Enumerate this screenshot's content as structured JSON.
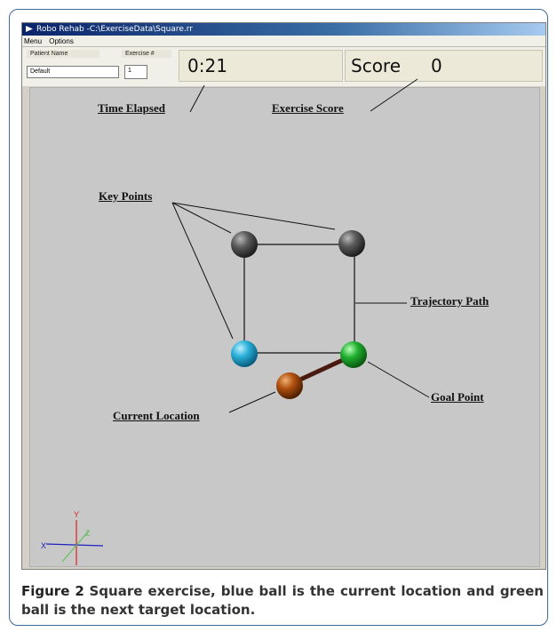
{
  "window": {
    "title": "Robo Rehab   -C:\\ExerciseData\\Square.rr",
    "menu": [
      "Menu",
      "Options"
    ]
  },
  "header": {
    "patient_name_label": "Patient Name",
    "patient_name_value": "Default",
    "exercise_label": "Exercise #",
    "exercise_value": "1",
    "time_value": "0:21",
    "score_label": "Score",
    "score_value": "0"
  },
  "annotations": {
    "time_elapsed": "Time Elapsed",
    "exercise_score": "Exercise Score",
    "key_points": "Key Points",
    "trajectory_path": "Trajectory Path",
    "goal_point": "Goal Point",
    "current_location": "Current Location"
  },
  "axes": {
    "x": "X",
    "y": "Y",
    "z": "Z"
  },
  "colors": {
    "key_point": "#5a5a5a",
    "current_point": "#2ab0d8",
    "goal_point": "#20b030",
    "cursor_ball": "#b05010",
    "link_bar": "#4a1a10",
    "title_bar": "#0a246a"
  },
  "caption": {
    "label": "Figure 2",
    "text": "Square exercise, blue ball is the current location and green ball is the next target location."
  }
}
